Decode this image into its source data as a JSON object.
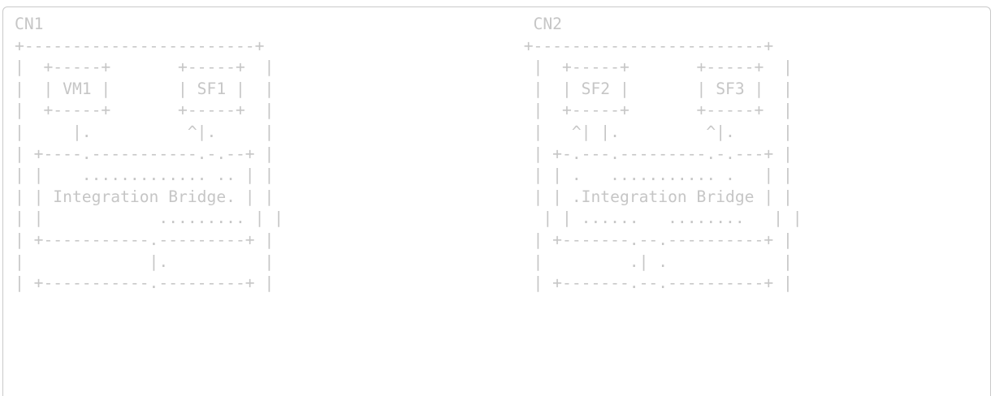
{
  "diagram": {
    "lines": [
      "CN1                                                   CN2",
      "+------------------------+                           +------------------------+",
      "|  +-----+       +-----+  |                           |  +-----+       +-----+  |",
      "|  | VM1 |       | SF1 |  |                           |  | SF2 |       | SF3 |  |",
      "|  +-----+       +-----+  |                           |  +-----+       +-----+  |",
      "|     |.          ^|.     |                           |   ^| |.         ^|.     |",
      "| +----.-----------.-.--+ |                           | +-.---.---------.-.---+ |",
      "| |    ............. .. | |                           | | .   ........... .   | |",
      "| | Integration Bridge. | |                           | | .Integration Bridge | |",
      "| |            ......... | |                           | | ......   ........   | |",
      "| +-----------.---------+ |                           | +-------.--.----------+ |",
      "|             |.          |                           |         .| .            |",
      "| +-----------.---------+ |                           | +-------.--.----------+ |"
    ]
  }
}
